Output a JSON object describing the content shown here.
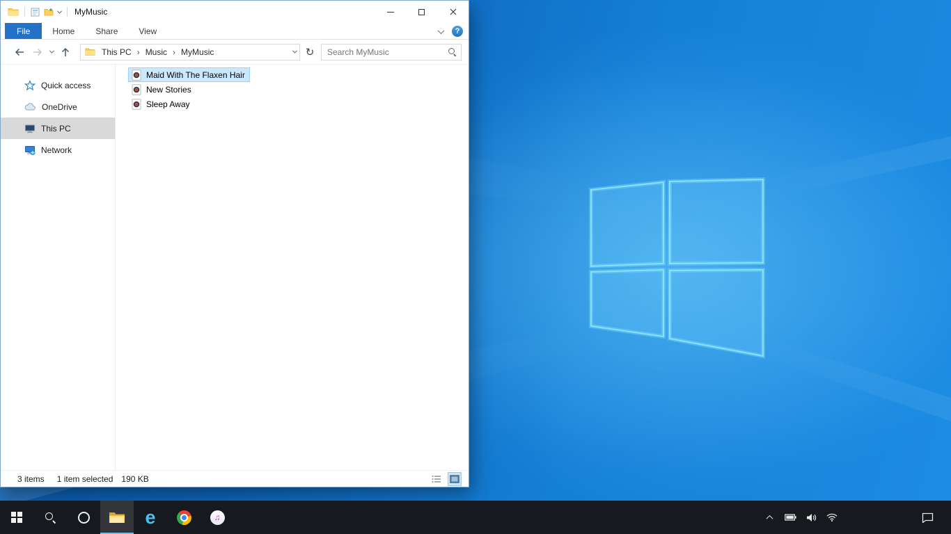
{
  "colors": {
    "accent": "#0078d7",
    "file_tab_blue": "#2472c8",
    "selection_fill": "#cce8ff",
    "selection_border": "#99d1ff",
    "sidebar_selected": "#d9d9d9",
    "taskbar_background": "#16191d",
    "desktop_blue": "#147fd6",
    "logo_line_cyan": "#86e3ff"
  },
  "window": {
    "title": "MyMusic"
  },
  "ribbon": {
    "tabs": [
      {
        "label": "File",
        "active": true
      },
      {
        "label": "Home",
        "active": false
      },
      {
        "label": "Share",
        "active": false
      },
      {
        "label": "View",
        "active": false
      }
    ],
    "help_glyph": "?"
  },
  "address": {
    "crumbs": [
      "This PC",
      "Music",
      "MyMusic"
    ],
    "separator": "›",
    "refresh_glyph": "↻"
  },
  "search": {
    "placeholder": "Search MyMusic"
  },
  "sidebar": {
    "items": [
      {
        "label": "Quick access",
        "icon": "star-icon",
        "selected": false
      },
      {
        "label": "OneDrive",
        "icon": "cloud-icon",
        "selected": false
      },
      {
        "label": "This PC",
        "icon": "computer-icon",
        "selected": true
      },
      {
        "label": "Network",
        "icon": "network-icon",
        "selected": false
      }
    ]
  },
  "files": {
    "items": [
      {
        "name": "Maid With The Flaxen Hair",
        "icon": "music-file-icon",
        "selected": true
      },
      {
        "name": "New Stories",
        "icon": "music-file-icon",
        "selected": false
      },
      {
        "name": "Sleep Away",
        "icon": "music-file-icon",
        "selected": false
      }
    ]
  },
  "statusbar": {
    "items_count": "3 items",
    "selected_count": "1 item selected",
    "selected_size": "190 KB"
  },
  "taskbar": {
    "buttons": [
      "start",
      "search",
      "cortana",
      "file-explorer",
      "internet-explorer",
      "chrome",
      "itunes"
    ],
    "active_button": "file-explorer",
    "itunes_note_glyph": "♫",
    "ie_letter": "e"
  }
}
